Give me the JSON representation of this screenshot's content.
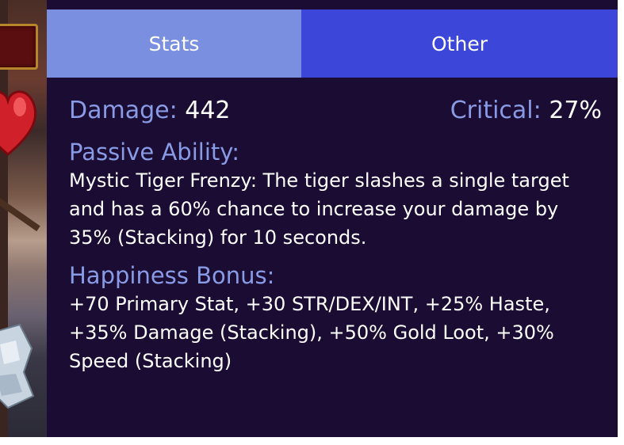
{
  "tabs": [
    {
      "label": "Stats"
    },
    {
      "label": "Other"
    }
  ],
  "active_tab": "Stats",
  "stats": {
    "damage_label": "Damage:",
    "damage_value": "442",
    "critical_label": "Critical:",
    "critical_value": "27%"
  },
  "passive": {
    "heading": "Passive Ability:",
    "text": "Mystic Tiger Frenzy: The tiger slashes a single target and has a 60% chance to increase your damage by 35% (Stacking) for 10 seconds."
  },
  "happiness": {
    "heading": "Happiness Bonus:",
    "text": "+70 Primary Stat, +30 STR/DEX/INT, +25% Haste, +35% Damage (Stacking), +50% Gold Loot, +30% Speed (Stacking)"
  },
  "colors": {
    "panel_bg": "#1a0c33",
    "tab_stats": "#7b8fe0",
    "tab_other": "#3c46d9",
    "label": "#8a9be6",
    "value": "#ffffff"
  },
  "icons": [
    "heart-icon",
    "health-bar-frame"
  ]
}
